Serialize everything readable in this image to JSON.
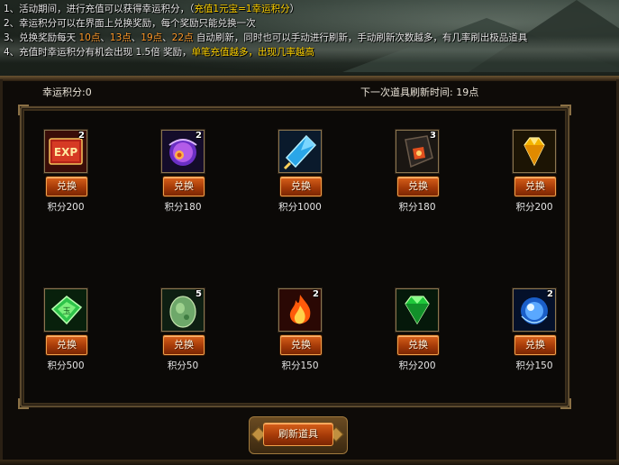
{
  "rules": [
    {
      "parts": [
        {
          "t": "1、活动期间，进行充值可以获得幸运积分，（",
          "c": ""
        },
        {
          "t": "充值1元宝=1幸运积分",
          "c": "hl"
        },
        {
          "t": "）",
          "c": ""
        }
      ]
    },
    {
      "parts": [
        {
          "t": "2、幸运积分可以在界面上兑换奖励，每个奖励只能兑换一次",
          "c": ""
        }
      ]
    },
    {
      "parts": [
        {
          "t": "3、兑换奖励每天 ",
          "c": ""
        },
        {
          "t": "10点",
          "c": "hl2"
        },
        {
          "t": "、",
          "c": ""
        },
        {
          "t": "13点",
          "c": "hl2"
        },
        {
          "t": "、",
          "c": ""
        },
        {
          "t": "19点",
          "c": "hl2"
        },
        {
          "t": "、",
          "c": ""
        },
        {
          "t": "22点",
          "c": "hl2"
        },
        {
          "t": " 自动刷新，同时也可以手动进行刷新，手动刷新次数越多，有几率刷出极品道具",
          "c": ""
        }
      ]
    },
    {
      "parts": [
        {
          "t": "4、充值时幸运积分有机会出现 1.5倍 奖励，",
          "c": ""
        },
        {
          "t": "单笔充值越多，出现几率越高",
          "c": "hl"
        }
      ]
    }
  ],
  "info": {
    "lucky_points": "幸运积分:0",
    "next_refresh": "下一次道具刷新时间: 19点"
  },
  "items": [
    {
      "icon": "exp-book-icon",
      "count": "2",
      "button": "兑换",
      "points": "积分200"
    },
    {
      "icon": "purple-orb-icon",
      "count": "2",
      "button": "兑换",
      "points": "积分180"
    },
    {
      "icon": "ice-crystal-icon",
      "count": "",
      "button": "兑换",
      "points": "积分1000"
    },
    {
      "icon": "dark-stone-icon",
      "count": "3",
      "button": "兑换",
      "points": "积分180"
    },
    {
      "icon": "yellow-gem-icon",
      "count": "",
      "button": "兑换",
      "points": "积分200"
    },
    {
      "icon": "green-jade-tablet-icon",
      "count": "",
      "button": "兑换",
      "points": "积分500"
    },
    {
      "icon": "jade-stone-icon",
      "count": "5",
      "button": "兑换",
      "points": "积分50"
    },
    {
      "icon": "fire-icon",
      "count": "2",
      "button": "兑换",
      "points": "积分150"
    },
    {
      "icon": "green-gem-icon",
      "count": "",
      "button": "兑换",
      "points": "积分200"
    },
    {
      "icon": "blue-orb-icon",
      "count": "2",
      "button": "兑换",
      "points": "积分150"
    }
  ],
  "refresh_button": "刷新道具",
  "colors": {
    "highlight_yellow": "#ffd200",
    "highlight_orange": "#ff9a2a",
    "button_orange": "#a53a08",
    "frame_gold": "#5c4a2e"
  }
}
